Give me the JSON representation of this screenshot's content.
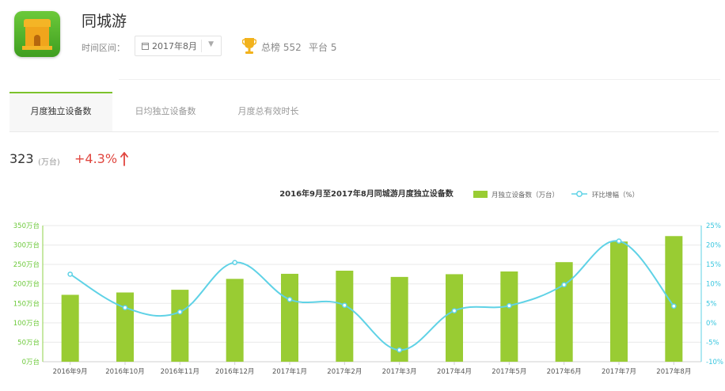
{
  "app": {
    "name": "同城游",
    "icon": "app-icon",
    "range_label": "时间区间：",
    "selected_month": "2017年8月",
    "rank_total": "总榜 552",
    "rank_platform": "平台 5"
  },
  "tabs": [
    {
      "label": "月度独立设备数",
      "active": true
    },
    {
      "label": "日均独立设备数",
      "active": false
    },
    {
      "label": "月度总有效时长",
      "active": false
    }
  ],
  "kpi": {
    "value": "323",
    "unit": "(万台)",
    "change": "+4.3%",
    "trend": "up"
  },
  "colors": {
    "bar": "#99cc33",
    "line": "#5fd2e6",
    "tab_accent": "#7cc22c",
    "change_up": "#e0463f"
  },
  "chart_data": {
    "type": "bar",
    "title": "2016年9月至2017年8月同城游月度独立设备数",
    "categories": [
      "2016年9月",
      "2016年10月",
      "2016年11月",
      "2016年12月",
      "2017年1月",
      "2017年2月",
      "2017年3月",
      "2017年4月",
      "2017年5月",
      "2017年6月",
      "2017年7月",
      "2017年8月"
    ],
    "series": [
      {
        "name": "月独立设备数（万台）",
        "type": "bar",
        "axis": "left",
        "values": [
          172,
          178,
          185,
          213,
          226,
          234,
          218,
          225,
          232,
          256,
          309,
          323
        ]
      },
      {
        "name": "环比增幅（%）",
        "type": "line",
        "axis": "right",
        "values": [
          12.5,
          3.9,
          2.8,
          15.5,
          6.0,
          4.5,
          -7.0,
          3.1,
          4.4,
          9.8,
          21.0,
          4.3
        ]
      }
    ],
    "left_axis": {
      "ylim": [
        0,
        350
      ],
      "ticks": [
        "0万台",
        "50万台",
        "100万台",
        "150万台",
        "200万台",
        "250万台",
        "300万台",
        "350万台"
      ]
    },
    "right_axis": {
      "ylim": [
        -10,
        25
      ],
      "ticks": [
        "-10%",
        "-5%",
        "0%",
        "5%",
        "10%",
        "15%",
        "20%",
        "25%"
      ]
    },
    "legend_position": "top-right",
    "grid": true
  }
}
